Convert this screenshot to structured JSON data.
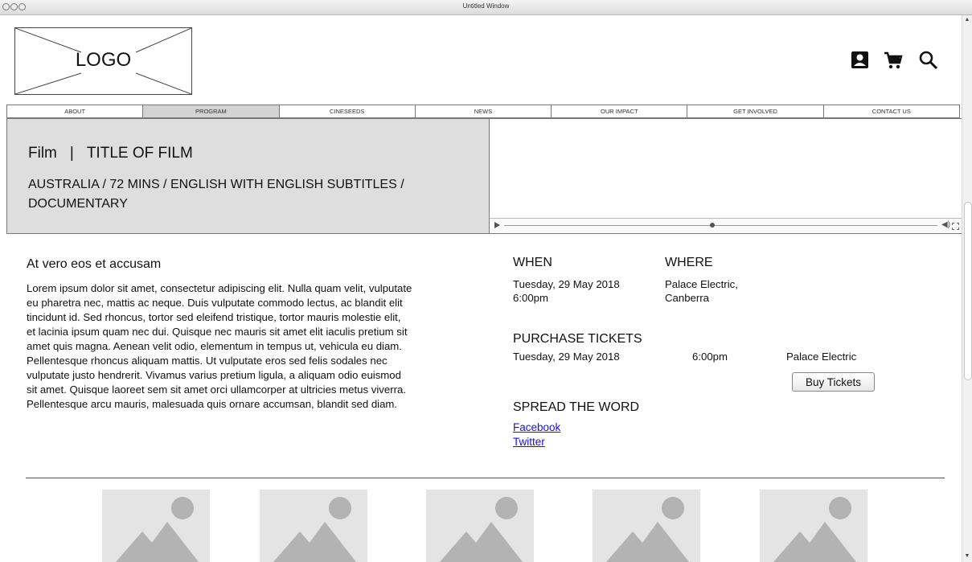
{
  "window": {
    "title": "Untitled Window"
  },
  "header": {
    "logo_text": "LOGO",
    "icons": [
      "account-icon",
      "cart-icon",
      "search-icon"
    ]
  },
  "nav": {
    "items": [
      {
        "label": "ABOUT",
        "active": false
      },
      {
        "label": "PROGRAM",
        "active": true
      },
      {
        "label": "CINESEEDS",
        "active": false
      },
      {
        "label": "NEWS",
        "active": false
      },
      {
        "label": "OUR IMPACT",
        "active": false
      },
      {
        "label": "GET INVOLVED",
        "active": false
      },
      {
        "label": "CONTACT US",
        "active": false
      }
    ]
  },
  "hero": {
    "category": "Film",
    "separator": "|",
    "title": "TITLE OF FILM",
    "meta": "AUSTRALIA / 72 MINS / ENGLISH WITH ENGLISH SUBTITLES / DOCUMENTARY"
  },
  "article": {
    "title": "At vero eos et accusam",
    "body": "Lorem ipsum dolor sit amet, consectetur adipiscing elit. Nulla quam velit, vulputate eu pharetra nec, mattis ac neque. Duis vulputate commodo lectus, ac blandit elit tincidunt id. Sed rhoncus, tortor sed eleifend tristique, tortor mauris molestie elit, et lacinia ipsum quam nec dui. Quisque nec mauris sit amet elit iaculis pretium sit amet quis magna. Aenean velit odio, elementum in tempus ut, vehicula eu diam. Pellentesque rhoncus aliquam mattis. Ut vulputate eros sed felis sodales nec vulputate justo hendrerit. Vivamus varius pretium ligula, a aliquam odio euismod sit amet. Quisque laoreet sem sit amet orci ullamcorper at ultricies metus viverra. Pellentesque arcu mauris, malesuada quis ornare accumsan, blandit sed diam."
  },
  "when": {
    "heading": "WHEN",
    "date": "Tuesday, 29 May 2018",
    "time": "6:00pm"
  },
  "where": {
    "heading": "WHERE",
    "line1": "Palace Electric,",
    "line2": "Canberra"
  },
  "tickets": {
    "heading": "PURCHASE TICKETS",
    "date": "Tuesday, 29 May 2018",
    "time": "6:00pm",
    "venue": "Palace Electric",
    "button": "Buy Tickets"
  },
  "share": {
    "heading": "SPREAD THE WORD",
    "facebook": "Facebook",
    "twitter": "Twitter"
  },
  "gallery": {
    "count": 5,
    "icon": "image-placeholder-icon"
  },
  "video": {
    "progress": 0.48
  }
}
